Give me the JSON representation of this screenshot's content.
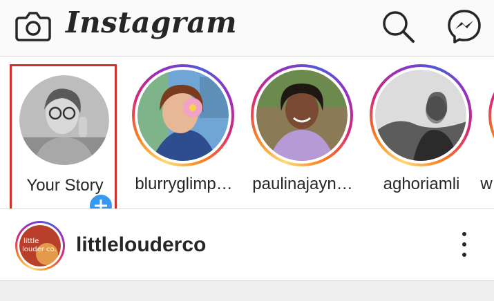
{
  "app": {
    "wordmark": "Instagram"
  },
  "header": {
    "icons": [
      "camera-icon",
      "search-icon",
      "messenger-icon"
    ]
  },
  "stories": [
    {
      "label": "Your Story",
      "is_own": true,
      "highlighted": true
    },
    {
      "label": "blurryglimp…",
      "is_own": false
    },
    {
      "label": "paulinajayn…",
      "is_own": false
    },
    {
      "label": "aghoriamli",
      "is_own": false
    },
    {
      "label": "w",
      "is_own": false
    }
  ],
  "post": {
    "username": "littlelouderco",
    "avatar_text": "little louder co."
  },
  "colors": {
    "highlight": "#d0312d",
    "add_badge": "#3897f0",
    "text": "#262626"
  }
}
